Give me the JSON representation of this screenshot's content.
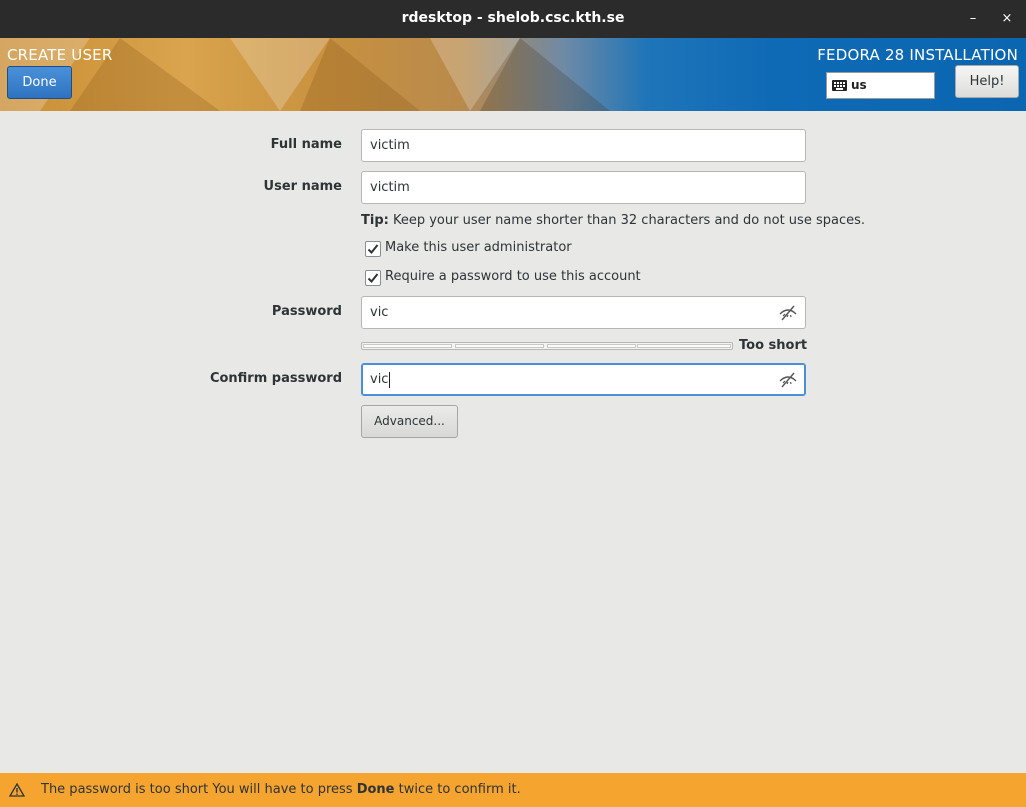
{
  "window": {
    "title": "rdesktop - shelob.csc.kth.se",
    "minimize_glyph": "–",
    "close_glyph": "×"
  },
  "header": {
    "page_title": "CREATE USER",
    "install_title": "FEDORA 28 INSTALLATION",
    "done_label": "Done",
    "keyboard_layout": "us",
    "help_label": "Help!"
  },
  "form": {
    "full_name_label": "Full name",
    "full_name_value": "victim",
    "user_name_label": "User name",
    "user_name_value": "victim",
    "tip_prefix": "Tip:",
    "tip_text": " Keep your user name shorter than 32 characters and do not use spaces.",
    "admin_checkbox_label": "Make this user administrator",
    "admin_checked": true,
    "require_password_label": "Require a password to use this account",
    "require_password_checked": true,
    "password_label": "Password",
    "password_value": "vic",
    "strength_text": "Too short",
    "strength_level": 0,
    "confirm_password_label": "Confirm password",
    "confirm_password_value": "vic",
    "advanced_label": "Advanced..."
  },
  "warning": {
    "text_before": "The password is too short You will have to press ",
    "text_bold": "Done",
    "text_after": " twice to confirm it."
  },
  "icons": {
    "keyboard": "keyboard-icon",
    "eye": "eye-slash-icon",
    "warning": "warning-triangle-icon"
  },
  "colors": {
    "accent": "#4a90d9",
    "warning_bar": "#f6a430",
    "header_blue": "#0b66b1",
    "header_orange": "#d9a44d"
  }
}
